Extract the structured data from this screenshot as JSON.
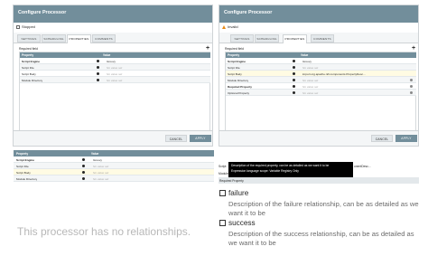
{
  "dialogs": [
    {
      "title": "Configure Processor",
      "state": "Stopped",
      "state_icon": "stopped-square-icon",
      "tabs": [
        "SETTINGS",
        "SCHEDULING",
        "PROPERTIES",
        "COMMENTS"
      ],
      "active_tab": "PROPERTIES",
      "required_field": "Required field",
      "columns": [
        "Property",
        "Value"
      ],
      "rows": [
        {
          "name": "Script Engine",
          "value": "Groovy",
          "placeholder": false,
          "bold": true
        },
        {
          "name": "Script File",
          "value": "No value set",
          "placeholder": true,
          "bold": false
        },
        {
          "name": "Script Body",
          "value": "No value set",
          "placeholder": true,
          "bold": false
        },
        {
          "name": "Module Directory",
          "value": "No value set",
          "placeholder": true,
          "bold": false
        }
      ],
      "cancel": "CANCEL",
      "apply": "APPLY"
    },
    {
      "title": "Configure Processor",
      "state": "Invalid",
      "state_icon": "warning-triangle-icon",
      "tabs": [
        "SETTINGS",
        "SCHEDULING",
        "PROPERTIES",
        "COMMENTS"
      ],
      "active_tab": "PROPERTIES",
      "required_field": "Required field",
      "columns": [
        "Property",
        "Value"
      ],
      "rows": [
        {
          "name": "Script Engine",
          "value": "Groovy",
          "placeholder": false,
          "bold": true
        },
        {
          "name": "Script File",
          "value": "No value set",
          "placeholder": true,
          "bold": false
        },
        {
          "name": "Script Body",
          "value": "import org.apache.nifi.components.PropertyDesc...",
          "placeholder": false,
          "bold": false
        },
        {
          "name": "Module Directory",
          "value": "No value set",
          "placeholder": true,
          "bold": false
        },
        {
          "name": "Required Property",
          "value": "No value set",
          "placeholder": true,
          "bold": true
        },
        {
          "name": "Optional Property",
          "value": "No value set",
          "placeholder": true,
          "bold": false
        }
      ],
      "cancel": "CANCEL",
      "apply": "APPLY"
    }
  ],
  "zoom_left": {
    "columns": [
      "Property",
      "Value"
    ],
    "rows": [
      {
        "name": "Script Engine",
        "value": "Groovy",
        "placeholder": false,
        "bold": true
      },
      {
        "name": "Script File",
        "value": "No value set",
        "placeholder": true,
        "bold": false
      },
      {
        "name": "Script Body",
        "value": "No value set",
        "placeholder": true,
        "bold": false
      },
      {
        "name": "Module Directory",
        "value": "No value set",
        "placeholder": true,
        "bold": false
      }
    ]
  },
  "zoom_right": {
    "row_labels": [
      "Script",
      "Module",
      "Required Property"
    ],
    "value_fragment": "onentDesc...",
    "tooltip_line1": "Description of the required property, can be as detailed as we want it to be",
    "tooltip_line2": "Expression language scope: Variable Registry Only"
  },
  "relationships": [
    {
      "name": "failure",
      "description": "Description of the failure relationship, can be as detailed as we want it to be"
    },
    {
      "name": "success",
      "description": "Description of the success relationship, can be as detailed as we want it to be"
    }
  ],
  "no_relationships": "This processor has no relationships.",
  "colors": {
    "header": "#728e9b",
    "accent_warn": "#e98a15",
    "selected_row": "#fffbe3"
  }
}
